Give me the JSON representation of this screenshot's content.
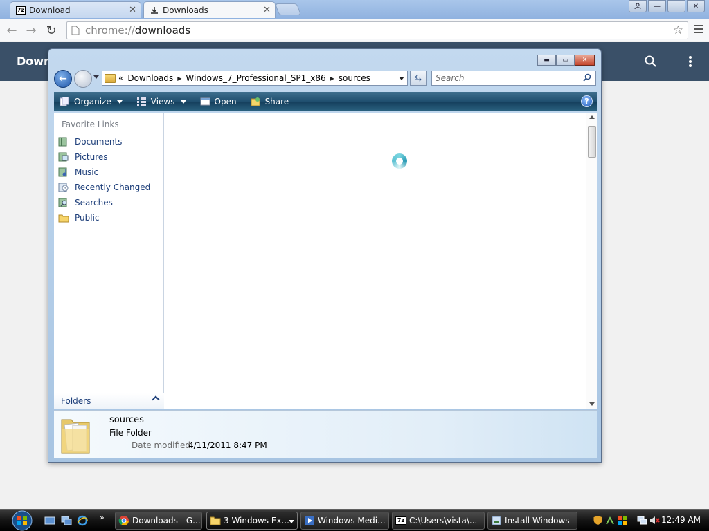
{
  "browser": {
    "tabs": [
      {
        "label": "Download",
        "active": false
      },
      {
        "label": "Downloads",
        "active": true
      }
    ],
    "url_scheme": "chrome://",
    "url_host": "downloads"
  },
  "downloads_page": {
    "title": "Downl"
  },
  "explorer": {
    "breadcrumb": {
      "prefix": "«",
      "crumbs": [
        "Downloads",
        "Windows_7_Professional_SP1_x86",
        "sources"
      ]
    },
    "search_placeholder": "Search",
    "commands": {
      "organize": "Organize",
      "views": "Views",
      "open": "Open",
      "share": "Share"
    },
    "nav": {
      "heading": "Favorite Links",
      "links": [
        "Documents",
        "Pictures",
        "Music",
        "Recently Changed",
        "Searches",
        "Public"
      ],
      "folders_label": "Folders"
    },
    "details": {
      "name": "sources",
      "type": "File Folder",
      "modified_label": "Date modified:",
      "modified_value": "4/11/2011 8:47 PM"
    }
  },
  "taskbar": {
    "tasks": [
      {
        "label": "Downloads - G...",
        "icon": "chrome-icon"
      },
      {
        "label": "3 Windows Ex...",
        "icon": "folder-icon"
      },
      {
        "label": "Windows Medi...",
        "icon": "media-icon"
      },
      {
        "label": "C:\\Users\\vista\\...",
        "icon": "7zip-icon"
      },
      {
        "label": "Install Windows",
        "icon": "installer-icon"
      }
    ],
    "clock": "12:49 AM",
    "quicklaunch_more": "»"
  },
  "colors": {
    "downloads_header": "#3a5068",
    "explorer_cmdbar": "#1f4e6e",
    "nav_link": "#1e3f7a"
  }
}
